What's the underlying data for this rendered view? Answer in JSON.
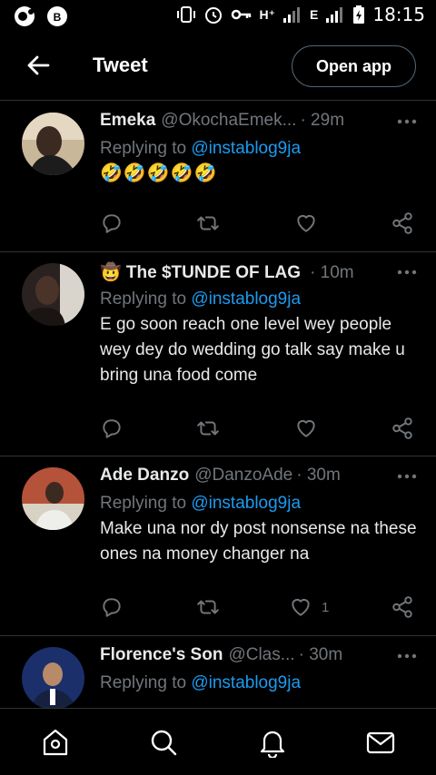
{
  "status_bar": {
    "network_a": "H⁺",
    "network_b": "E",
    "time": "18:15"
  },
  "header": {
    "title": "Tweet",
    "open_app_label": "Open app"
  },
  "tweets": [
    {
      "name": "Emeka",
      "handle": "@OkochaEmek...",
      "time": "· 29m",
      "replying_prefix": "Replying to",
      "replying_to": "@instablog9ja",
      "text": "🤣🤣🤣🤣🤣",
      "likes": ""
    },
    {
      "name": "🤠 The $TUNDE OF LAG",
      "handle": "",
      "time": "· 10m",
      "replying_prefix": "Replying to",
      "replying_to": "@instablog9ja",
      "text": "E go soon reach one level wey people wey dey do wedding go talk say make u bring una food come",
      "likes": ""
    },
    {
      "name": "Ade Danzo",
      "handle": "@DanzoAde",
      "time": "· 30m",
      "replying_prefix": "Replying to",
      "replying_to": "@instablog9ja",
      "text": "Make una nor dy post nonsense na these ones na money changer na",
      "likes": "1"
    },
    {
      "name": "Florence's Son",
      "handle": "@Clas...",
      "time": "· 30m",
      "replying_prefix": "Replying to",
      "replying_to": "@instablog9ja",
      "text": "",
      "likes": ""
    }
  ],
  "colors": {
    "background": "#000000",
    "accent": "#1d9bf0",
    "muted": "#71767b",
    "divider": "#2f3336"
  },
  "icons": {
    "back": "arrow-left-icon",
    "more": "more-dots-icon",
    "reply": "reply-icon",
    "retweet": "retweet-icon",
    "like": "heart-icon",
    "share": "share-icon",
    "home": "home-icon",
    "search": "search-icon",
    "notifications": "bell-icon",
    "messages": "mail-icon"
  }
}
